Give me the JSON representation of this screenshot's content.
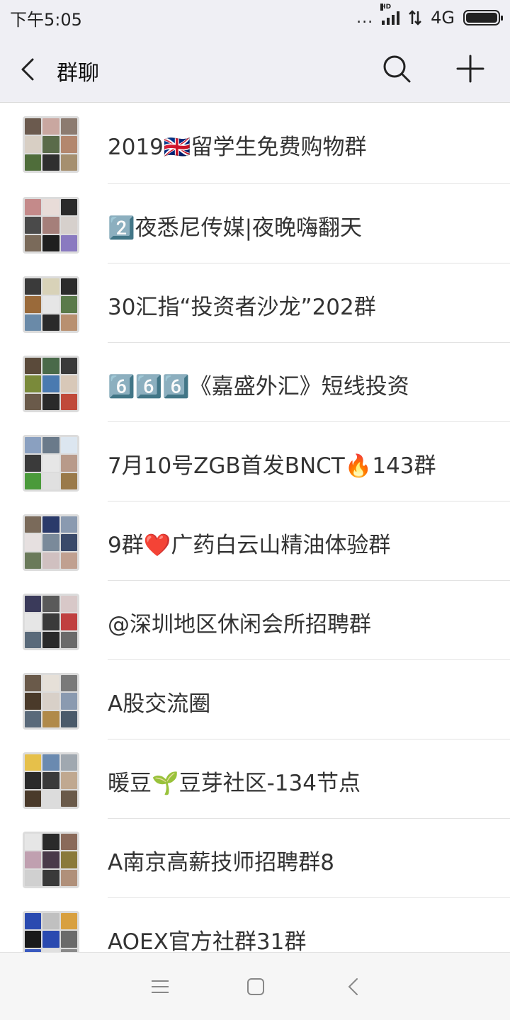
{
  "status": {
    "time": "下午5:05",
    "dots": "...",
    "network": "4G",
    "hd": "HD"
  },
  "header": {
    "title": "群聊"
  },
  "groups": [
    {
      "name": "2019🇬🇧留学生免费购物群",
      "palette": [
        "#6b5a4e",
        "#c9a7a0",
        "#8c7b70",
        "#d8cfc4",
        "#5a6b4a",
        "#b3876e",
        "#4f6d3a",
        "#2f2f2f",
        "#a58f6f"
      ]
    },
    {
      "name": "2️⃣夜悉尼传媒|夜晚嗨翻天",
      "palette": [
        "#c48a8a",
        "#e8dcd8",
        "#2a2a2a",
        "#4a4a4a",
        "#a57f7a",
        "#d6d0cc",
        "#7a6a5a",
        "#1f1f1f",
        "#8a7ac0"
      ]
    },
    {
      "name": "30汇指“投资者沙龙”202群",
      "palette": [
        "#3a3a3a",
        "#d8d2b8",
        "#2b2b2b",
        "#9a6a3a",
        "#e6e6e6",
        "#5a7a4a",
        "#6a8aa8",
        "#2a2a2a",
        "#b89070"
      ]
    },
    {
      "name": "6️⃣6️⃣6️⃣《嘉盛外汇》短线投资",
      "palette": [
        "#5a4a3a",
        "#4a6a4a",
        "#3a3a3a",
        "#7a8a3a",
        "#4a7ab0",
        "#d8c8b8",
        "#6a5a4a",
        "#2a2a2a",
        "#c04a3a"
      ]
    },
    {
      "name": "7月10号ZGB首发BNCT🔥143群",
      "palette": [
        "#8aa0c0",
        "#6a7a8a",
        "#dce6f0",
        "#3a3a3a",
        "#e6e6e6",
        "#b89a8a",
        "#4a9a3a",
        "#e0e0e0",
        "#9a7a4a"
      ]
    },
    {
      "name": "9群❤️广药白云山精油体验群",
      "palette": [
        "#7a6a5a",
        "#2a3a6a",
        "#8a9ab0",
        "#e6e0e0",
        "#7a8a9a",
        "#3a4a6a",
        "#6a7a5a",
        "#d0c0c0",
        "#c0a090"
      ]
    },
    {
      "name": "@深圳地区休闲会所招聘群",
      "palette": [
        "#3a3a5a",
        "#5a5a5a",
        "#d8c8c8",
        "#e6e6e6",
        "#3a3a3a",
        "#c04040",
        "#5a6a7a",
        "#2a2a2a",
        "#6a6a6a"
      ]
    },
    {
      "name": "A股交流圈",
      "palette": [
        "#6a5a4a",
        "#e6e0d8",
        "#7a7a7a",
        "#4a3a2a",
        "#d8d0c8",
        "#8a9ab0",
        "#5a6a7a",
        "#b08a4a",
        "#4a5a6a"
      ]
    },
    {
      "name": "暖豆🌱豆芽社区-134节点",
      "palette": [
        "#e6c04a",
        "#6a8ab0",
        "#a0a8b0",
        "#2a2a2a",
        "#3a3a3a",
        "#c0a890",
        "#4a3a2a",
        "#dcdcdc",
        "#6a5a4a"
      ]
    },
    {
      "name": "A南京高薪技师招聘群8",
      "palette": [
        "#e6e6e6",
        "#2a2a2a",
        "#8a6a5a",
        "#c0a0b0",
        "#4a3a4a",
        "#8a7a3a",
        "#d0d0d0",
        "#3a3a3a",
        "#b0907a"
      ]
    },
    {
      "name": "AOEX官方社群31群",
      "palette": [
        "#2a4ab0",
        "#c0c0c0",
        "#d8a040",
        "#1a1a1a",
        "#2a4ab0",
        "#6a6a6a",
        "#3a5ac0",
        "#e0e0e0",
        "#8a8a8a"
      ]
    }
  ],
  "nav": {
    "menu_icon": "menu-icon",
    "home_icon": "home-icon",
    "back_icon": "back-icon"
  }
}
